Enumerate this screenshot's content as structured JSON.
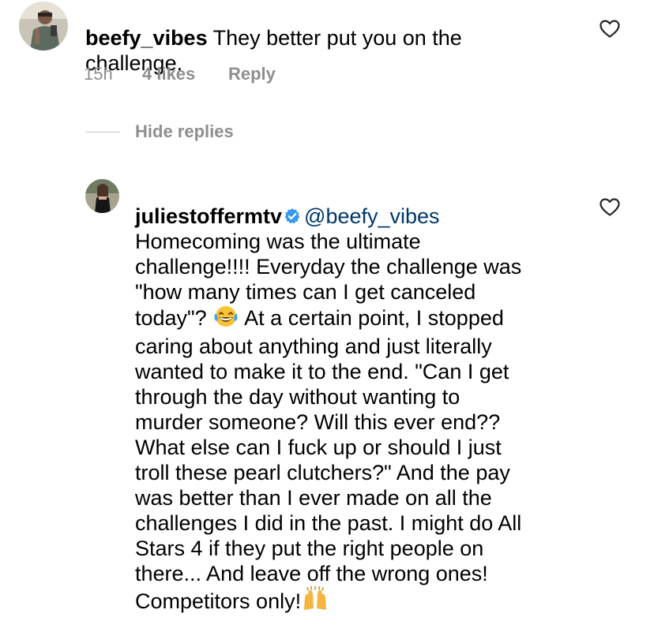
{
  "comment": {
    "username": "beefy_vibes",
    "text_line1": " They better put you on the",
    "text_line2": "challenge.",
    "time": "15h",
    "likes": "4 likes",
    "reply": "Reply",
    "like_icon": "heart-outline-icon"
  },
  "replies_toggle": {
    "label": "Hide replies"
  },
  "reply": {
    "username": "juliestoffermtv",
    "verified_icon": "verified-badge-icon",
    "mention": "@beefy_vibes",
    "text_before_emoji": "Homecoming was the ultimate\nchallenge!!!! Everyday the challenge was\n\"how many times can I get canceled\ntoday\"? ",
    "text_after_emoji": " At a certain point, I stopped\ncaring about anything and just literally\nwanted to make it to the end. \"Can I get\nthrough the day without wanting to\nmurder someone? Will this ever end??\nWhat else can I fuck up or should I just\ntroll these pearl clutchers?\" And the pay\nwas better than I ever made on all the\nchallenges I did in the past. I might do All\nStars 4 if they put the right people on\nthere... And leave off the wrong ones!\nCompetitors only!",
    "emoji1": "laughing-tears-emoji",
    "emoji2": "raised-hands-emoji",
    "like_icon": "heart-outline-icon"
  },
  "colors": {
    "text": "#000000",
    "meta": "#8e8e8e",
    "mention": "#00376b",
    "verified": "#3897f0"
  }
}
